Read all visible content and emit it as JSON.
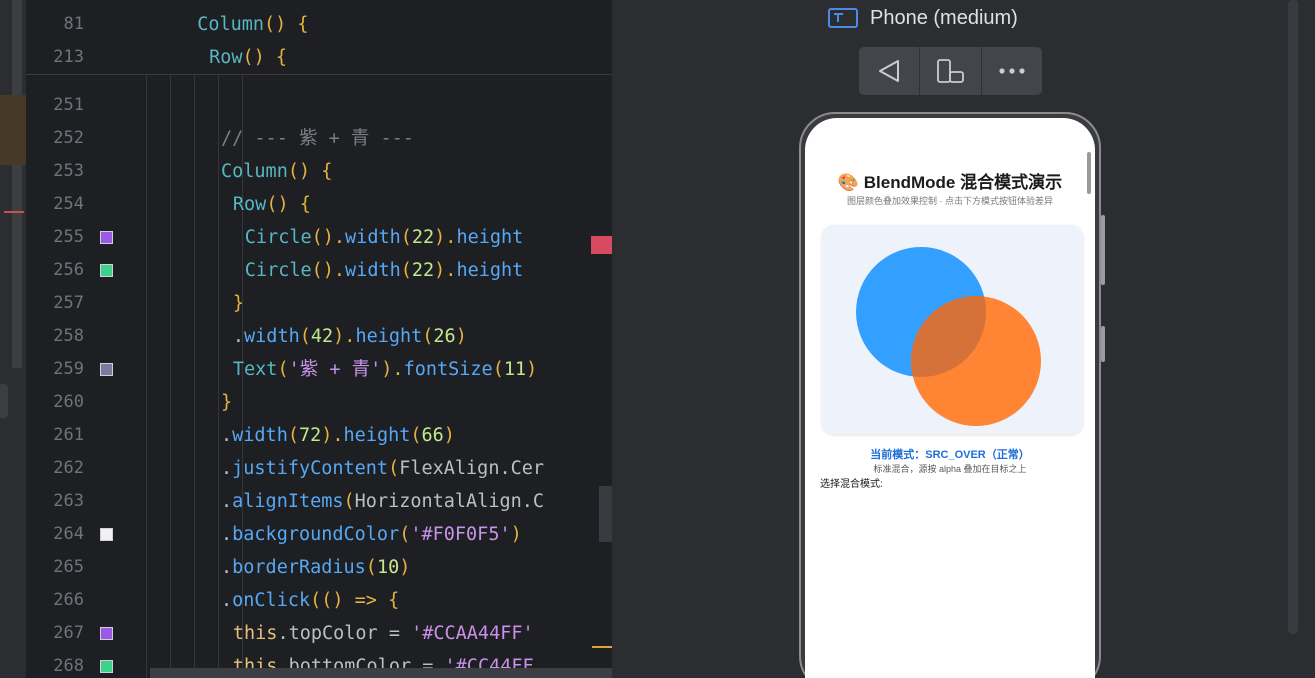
{
  "editor": {
    "sticky_lines": [
      {
        "ln": "81",
        "indent": 8,
        "tokens": [
          {
            "t": "Column",
            "c": "comp"
          },
          {
            "t": "() {",
            "c": "punc"
          }
        ]
      },
      {
        "ln": "213",
        "indent": 9,
        "tokens": [
          {
            "t": "Row",
            "c": "comp"
          },
          {
            "t": "() {",
            "c": "punc"
          }
        ]
      }
    ],
    "lines": [
      {
        "ln": "251",
        "swatch": null,
        "indent": 0,
        "tokens": []
      },
      {
        "ln": "252",
        "swatch": null,
        "indent": 10,
        "tokens": [
          {
            "t": "// --- 紫 + 青 ---",
            "c": "cmt"
          }
        ]
      },
      {
        "ln": "253",
        "swatch": null,
        "indent": 10,
        "tokens": [
          {
            "t": "Column",
            "c": "comp"
          },
          {
            "t": "() {",
            "c": "punc"
          }
        ]
      },
      {
        "ln": "254",
        "swatch": null,
        "indent": 11,
        "tokens": [
          {
            "t": "Row",
            "c": "comp"
          },
          {
            "t": "() {",
            "c": "punc"
          }
        ]
      },
      {
        "ln": "255",
        "swatch": "#9b59e6",
        "indent": 12,
        "tokens": [
          {
            "t": "Circle",
            "c": "comp"
          },
          {
            "t": "().",
            "c": "punc"
          },
          {
            "t": "width",
            "c": "meth"
          },
          {
            "t": "(",
            "c": "punc"
          },
          {
            "t": "22",
            "c": "num"
          },
          {
            "t": ").",
            "c": "punc"
          },
          {
            "t": "height",
            "c": "meth"
          }
        ]
      },
      {
        "ln": "256",
        "swatch": "#3fd18b",
        "indent": 12,
        "tokens": [
          {
            "t": "Circle",
            "c": "comp"
          },
          {
            "t": "().",
            "c": "punc"
          },
          {
            "t": "width",
            "c": "meth"
          },
          {
            "t": "(",
            "c": "punc"
          },
          {
            "t": "22",
            "c": "num"
          },
          {
            "t": ").",
            "c": "punc"
          },
          {
            "t": "height",
            "c": "meth"
          }
        ]
      },
      {
        "ln": "257",
        "swatch": null,
        "indent": 11,
        "tokens": [
          {
            "t": "}",
            "c": "punc"
          }
        ]
      },
      {
        "ln": "258",
        "swatch": null,
        "indent": 11,
        "tokens": [
          {
            "t": ".",
            "c": "plain"
          },
          {
            "t": "width",
            "c": "meth"
          },
          {
            "t": "(",
            "c": "punc"
          },
          {
            "t": "42",
            "c": "num"
          },
          {
            "t": ").",
            "c": "punc"
          },
          {
            "t": "height",
            "c": "meth"
          },
          {
            "t": "(",
            "c": "punc"
          },
          {
            "t": "26",
            "c": "num"
          },
          {
            "t": ")",
            "c": "punc"
          }
        ]
      },
      {
        "ln": "259",
        "swatch": "#7c7a9c",
        "indent": 11,
        "tokens": [
          {
            "t": "Text",
            "c": "comp"
          },
          {
            "t": "(",
            "c": "punc"
          },
          {
            "t": "'紫 + 青'",
            "c": "str"
          },
          {
            "t": ").",
            "c": "punc"
          },
          {
            "t": "fontSize",
            "c": "meth"
          },
          {
            "t": "(",
            "c": "punc"
          },
          {
            "t": "11",
            "c": "num"
          },
          {
            "t": ")",
            "c": "punc"
          }
        ]
      },
      {
        "ln": "260",
        "swatch": null,
        "indent": 10,
        "tokens": [
          {
            "t": "}",
            "c": "punc"
          }
        ]
      },
      {
        "ln": "261",
        "swatch": null,
        "indent": 10,
        "tokens": [
          {
            "t": ".",
            "c": "plain"
          },
          {
            "t": "width",
            "c": "meth"
          },
          {
            "t": "(",
            "c": "punc"
          },
          {
            "t": "72",
            "c": "num"
          },
          {
            "t": ").",
            "c": "punc"
          },
          {
            "t": "height",
            "c": "meth"
          },
          {
            "t": "(",
            "c": "punc"
          },
          {
            "t": "66",
            "c": "num"
          },
          {
            "t": ")",
            "c": "punc"
          }
        ]
      },
      {
        "ln": "262",
        "swatch": null,
        "indent": 10,
        "tokens": [
          {
            "t": ".",
            "c": "plain"
          },
          {
            "t": "justifyContent",
            "c": "meth"
          },
          {
            "t": "(",
            "c": "punc"
          },
          {
            "t": "FlexAlign.Cer",
            "c": "plain"
          }
        ]
      },
      {
        "ln": "263",
        "swatch": null,
        "indent": 10,
        "tokens": [
          {
            "t": ".",
            "c": "plain"
          },
          {
            "t": "alignItems",
            "c": "meth"
          },
          {
            "t": "(",
            "c": "punc"
          },
          {
            "t": "HorizontalAlign.C",
            "c": "plain"
          }
        ]
      },
      {
        "ln": "264",
        "swatch": "#f0f0f5",
        "indent": 10,
        "tokens": [
          {
            "t": ".",
            "c": "plain"
          },
          {
            "t": "backgroundColor",
            "c": "meth"
          },
          {
            "t": "(",
            "c": "punc"
          },
          {
            "t": "'#F0F0F5'",
            "c": "str"
          },
          {
            "t": ")",
            "c": "punc"
          }
        ]
      },
      {
        "ln": "265",
        "swatch": null,
        "indent": 10,
        "tokens": [
          {
            "t": ".",
            "c": "plain"
          },
          {
            "t": "borderRadius",
            "c": "meth"
          },
          {
            "t": "(",
            "c": "punc"
          },
          {
            "t": "10",
            "c": "num"
          },
          {
            "t": ")",
            "c": "punc"
          }
        ]
      },
      {
        "ln": "266",
        "swatch": null,
        "indent": 10,
        "tokens": [
          {
            "t": ".",
            "c": "plain"
          },
          {
            "t": "onClick",
            "c": "meth"
          },
          {
            "t": "(() => {",
            "c": "punc"
          }
        ]
      },
      {
        "ln": "267",
        "swatch": "#9b59e6",
        "indent": 11,
        "tokens": [
          {
            "t": "this",
            "c": "kw"
          },
          {
            "t": ".topColor = ",
            "c": "plain"
          },
          {
            "t": "'#CCAA44FF'",
            "c": "str"
          }
        ]
      },
      {
        "ln": "268",
        "swatch": "#3fd18b",
        "indent": 11,
        "tokens": [
          {
            "t": "this",
            "c": "kw"
          },
          {
            "t": ".bottomColor = ",
            "c": "plain"
          },
          {
            "t": "'#CC44FF",
            "c": "str"
          }
        ]
      }
    ]
  },
  "preview": {
    "device_label": "Phone (medium)",
    "toolbar": {
      "back_icon": "back-triangle-icon",
      "fold_icon": "device-rotate-icon",
      "more_icon": "more-dots-icon"
    },
    "app": {
      "title": "🎨 BlendMode 混合模式演示",
      "subtitle": "图层颜色叠加效果控制 · 点击下方模式按钮体验差异",
      "mode_label": "当前模式：SRC_OVER（正常）",
      "mode_desc": "标准混合，源按 alpha 叠加在目标之上",
      "select_label": "选择混合模式:",
      "circle_top_color": "#33a0ff",
      "circle_bottom_color": "#ff8433"
    }
  }
}
